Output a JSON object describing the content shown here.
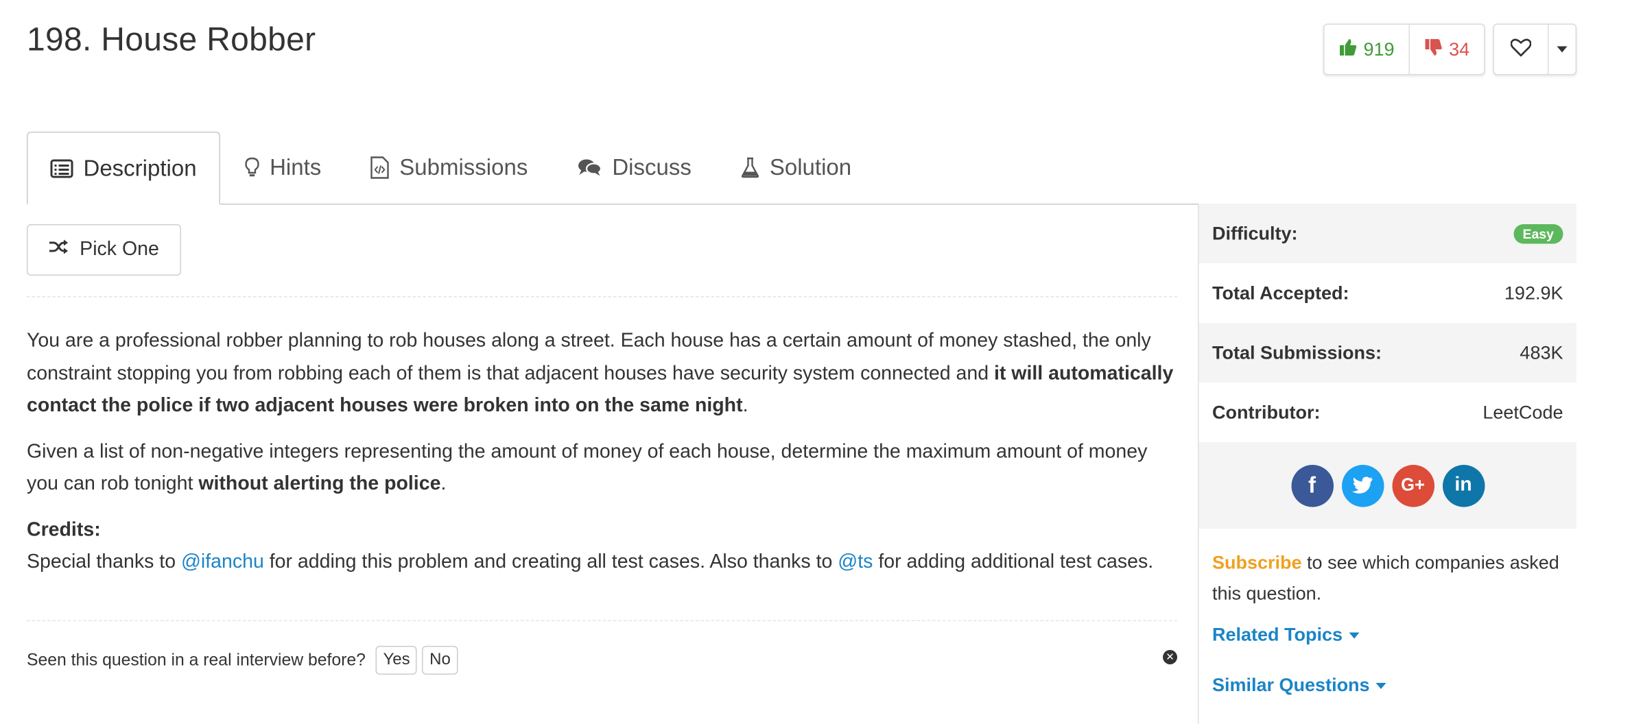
{
  "problem": {
    "title": "198. House Robber"
  },
  "votes": {
    "up": "919",
    "down": "34"
  },
  "tabs": [
    {
      "label": "Description",
      "icon": "list-icon"
    },
    {
      "label": "Hints",
      "icon": "lightbulb-icon"
    },
    {
      "label": "Submissions",
      "icon": "file-code-icon"
    },
    {
      "label": "Discuss",
      "icon": "comments-icon"
    },
    {
      "label": "Solution",
      "icon": "flask-icon"
    }
  ],
  "pick_one": {
    "label": "Pick One"
  },
  "description": {
    "p1_plain": "You are a professional robber planning to rob houses along a street. Each house has a certain amount of money stashed, the only constraint stopping you from robbing each of them is that adjacent houses have security system connected and ",
    "p1_bold": "it will automatically contact the police if two adjacent houses were broken into on the same night",
    "p1_end": ".",
    "p2_plain": "Given a list of non-negative integers representing the amount of money of each house, determine the maximum amount of money you can rob tonight ",
    "p2_bold": "without alerting the police",
    "p2_end": ".",
    "credits_label": "Credits:",
    "credits_1": "Special thanks to ",
    "credits_link1": "@ifanchu",
    "credits_2": " for adding this problem and creating all test cases. Also thanks to ",
    "credits_link2": "@ts",
    "credits_3": " for adding additional test cases."
  },
  "interview": {
    "question": "Seen this question in a real interview before?",
    "yes": "Yes",
    "no": "No"
  },
  "sidebar": {
    "difficulty_label": "Difficulty:",
    "difficulty_value": "Easy",
    "accepted_label": "Total Accepted:",
    "accepted_value": "192.9K",
    "submissions_label": "Total Submissions:",
    "submissions_value": "483K",
    "contributor_label": "Contributor:",
    "contributor_value": "LeetCode",
    "social": [
      {
        "name": "facebook",
        "glyph": "f",
        "color": "#3b5998"
      },
      {
        "name": "twitter",
        "glyph": "t",
        "color": "#1da1f2"
      },
      {
        "name": "google-plus",
        "glyph": "G+",
        "color": "#dd4b39"
      },
      {
        "name": "linkedin",
        "glyph": "in",
        "color": "#0e76a8"
      }
    ],
    "subscribe_link": "Subscribe",
    "subscribe_text": " to see which companies asked this question.",
    "related_topics": "Related Topics",
    "similar_questions": "Similar Questions"
  },
  "colors": {
    "accent_blue": "#1a84c7",
    "easy_green": "#5cb85c",
    "upvote_green": "#3f9c35",
    "downvote_red": "#d9534f",
    "subscribe_orange": "#f0a020"
  }
}
